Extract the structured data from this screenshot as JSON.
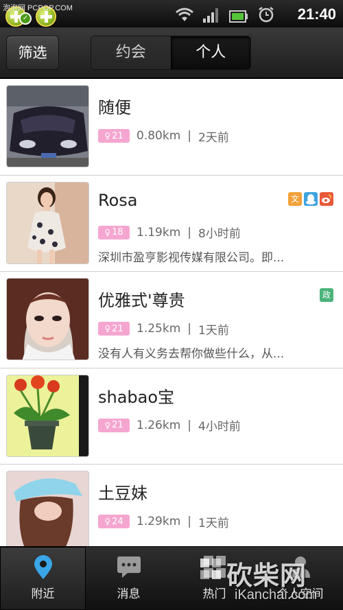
{
  "statusbar": {
    "watermark": "泡泡网 PCPOP.COM",
    "time": "21:40",
    "icons": [
      "app-add-icon",
      "app-add-check-icon",
      "wifi-icon",
      "signal-icon",
      "battery-icon",
      "alarm-icon"
    ]
  },
  "header": {
    "filter_label": "筛选",
    "tabs": [
      {
        "label": "约会",
        "active": false
      },
      {
        "label": "个人",
        "active": true
      }
    ]
  },
  "users": [
    {
      "name": "随便",
      "age": "21",
      "distance": "0.80km",
      "time": "2天前",
      "signature": "",
      "badges": []
    },
    {
      "name": "Rosa",
      "age": "18",
      "distance": "1.19km",
      "time": "8小时前",
      "signature": "深圳市盈亨影视传媒有限公司。即...",
      "badges": [
        {
          "icon": "wen-badge-icon",
          "text": "文",
          "color": "#f2a23a"
        },
        {
          "icon": "qq-badge-icon",
          "text": "",
          "color": "#3fa3e0"
        },
        {
          "icon": "weibo-badge-icon",
          "text": "",
          "color": "#e85a3a"
        }
      ]
    },
    {
      "name": "优雅式'尊贵",
      "age": "21",
      "distance": "1.25km",
      "time": "1天前",
      "signature": "没有人有义务去帮你做些什么，从...",
      "badges": [
        {
          "icon": "zheng-badge-icon",
          "text": "政",
          "color": "#4bb37a"
        }
      ]
    },
    {
      "name": "shabao宝",
      "age": "21",
      "distance": "1.26km",
      "time": "4小时前",
      "signature": "",
      "badges": []
    },
    {
      "name": "土豆妹",
      "age": "24",
      "distance": "1.29km",
      "time": "1天前",
      "signature": "",
      "badges": []
    }
  ],
  "tabbar": [
    {
      "label": "附近",
      "icon": "location-pin-icon",
      "active": true
    },
    {
      "label": "消息",
      "icon": "message-icon",
      "active": false
    },
    {
      "label": "热门",
      "icon": "grid-icon",
      "active": false
    },
    {
      "label": "个人空间",
      "icon": "person-icon",
      "active": false
    }
  ],
  "watermark": {
    "cn": "砍柴网",
    "en": "iKanchai.com"
  },
  "colors": {
    "age_badge": "#f5a6d0",
    "header_bg": "#2a2a2a",
    "tab_active_icon": "#3aa6e8"
  }
}
